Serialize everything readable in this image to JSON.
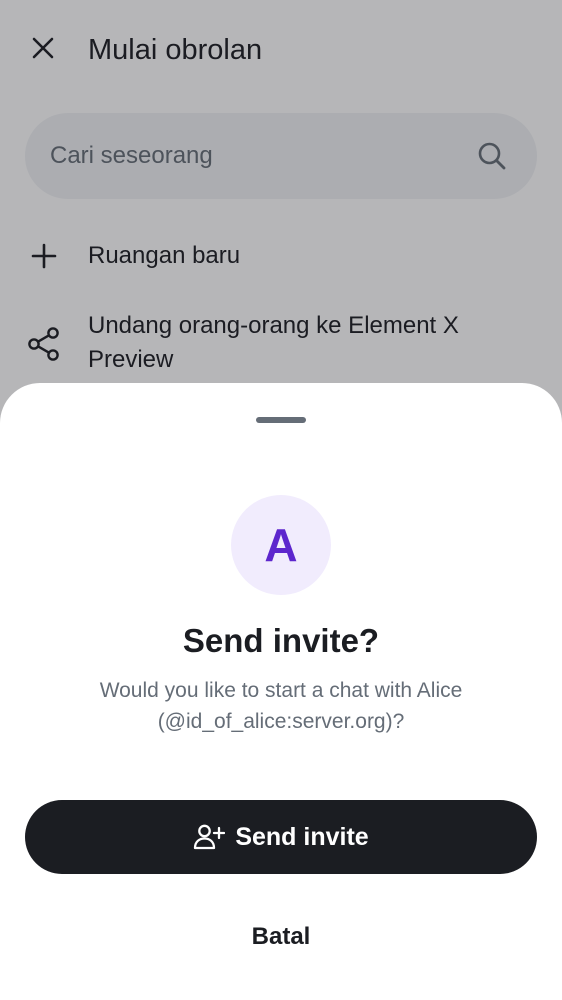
{
  "screen": {
    "title": "Mulai obrolan",
    "close_icon": "close-icon",
    "search": {
      "value": "",
      "placeholder": "Cari seseorang",
      "icon": "search-icon"
    },
    "actions": [
      {
        "label": "Ruangan baru",
        "icon": "plus-icon"
      },
      {
        "label": "Undang orang-orang ke Element X Preview",
        "icon": "share-icon"
      }
    ]
  },
  "dialog": {
    "avatar_letter": "A",
    "title": "Send invite?",
    "message": "Would you like to start a chat with Alice (@id_of_alice:server.org)?",
    "primary_button": {
      "label": "Send invite",
      "icon": "user-add-icon"
    },
    "secondary_button": {
      "label": "Batal"
    }
  },
  "colors": {
    "text_primary": "#1b1d22",
    "text_secondary": "#656d77",
    "avatar_background": "#f1ecfd",
    "avatar_text": "#5d26cd",
    "primary_button_background": "#1b1d22",
    "search_background": "#f0f2f5"
  }
}
